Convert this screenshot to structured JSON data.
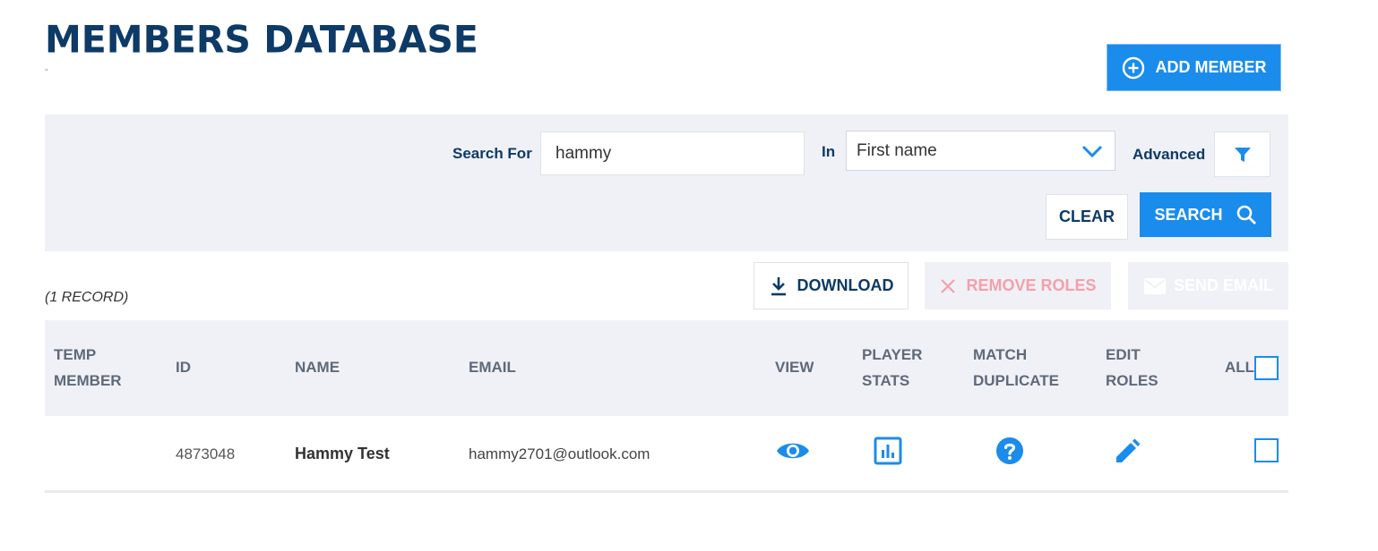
{
  "header": {
    "title": "MEMBERS DATABASE",
    "subtitle_mark": "\"",
    "add_member_label": "ADD MEMBER"
  },
  "search": {
    "search_for_label": "Search For",
    "query_value": "hammy",
    "in_label": "In",
    "field_selected": "First name",
    "advanced_label": "Advanced",
    "clear_label": "CLEAR",
    "search_label": "SEARCH"
  },
  "toolbar": {
    "record_count": "(1 RECORD)",
    "download_label": "DOWNLOAD",
    "remove_roles_label": "REMOVE ROLES",
    "send_email_label": "SEND EMAIL"
  },
  "table": {
    "headers": {
      "temp_member": [
        "TEMP",
        "MEMBER"
      ],
      "id": "ID",
      "name": "NAME",
      "email": "EMAIL",
      "view": "VIEW",
      "player_stats": [
        "PLAYER",
        "STATS"
      ],
      "match_duplicate": [
        "MATCH",
        "DUPLICATE"
      ],
      "edit_roles": [
        "EDIT",
        "ROLES"
      ],
      "all": "ALL"
    },
    "rows": [
      {
        "temp_member": "",
        "id": "4873048",
        "name": "Hammy Test",
        "email": "hammy2701@outlook.com",
        "icons": [
          "eye-icon",
          "bar-chart-icon",
          "question-icon",
          "pencil-icon"
        ]
      }
    ]
  },
  "colors": {
    "accent": "#1a8ceb",
    "navy": "#0d3a66",
    "panel": "#f0f1f6",
    "disabled_red": "#f4a0aa"
  }
}
